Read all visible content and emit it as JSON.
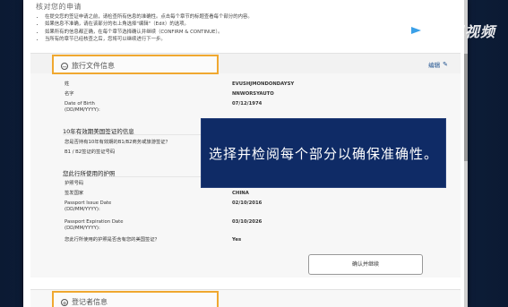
{
  "notes": {
    "heading": "核对您的申请",
    "items": [
      "在提交您的签证申请之前，请检查所有信息的准确性。点击每个章节的标题查看每个部分的内容。",
      "如果信息不准确，请在该部分的右上角选择\"编辑\"（Edit）的选项。",
      "如果所有的信息都正确，在每个章节选择确认并继续（CONFIRM & CONTINUE）。",
      "当所有的章节已经核查之后，您将可以继续进行下一步。"
    ]
  },
  "review": {
    "section_title": "旅行文件信息",
    "edit_label": "编辑",
    "fields": [
      {
        "label": "姓",
        "value": "EVUSHJMONDONDAYSY"
      },
      {
        "label": "名字",
        "value": "NNWORSYAUTO"
      },
      {
        "label": "Date of Birth (DD/MM/YYYY):",
        "value": "07/12/1974"
      }
    ],
    "visa_subtitle": "10年有效期美国签证的信息",
    "visa_fields": [
      {
        "label": "您是否持有10年有效期的B1/B2商务或旅游签证？"
      },
      {
        "label": "B1 / B2签证的签证号码"
      }
    ],
    "passport_subtitle": "您此行所使用的护照",
    "passport_fields": [
      {
        "label": "护照号码",
        "value": ""
      },
      {
        "label": "签发国家",
        "value": "CHINA"
      },
      {
        "label": "Passport Issue Date (DD/MM/YYYY):",
        "value": "02/10/2016"
      },
      {
        "label": "Passport Expiration Date (DD/MM/YYYY):",
        "value": "03/10/2026"
      },
      {
        "label": "您此行所使用的护照是否含有您的美国签证？",
        "value": "Yes"
      }
    ],
    "confirm_label": "确认并继续"
  },
  "registrant": {
    "section_title": "登记者信息"
  },
  "overlay": {
    "subtitle": "选择并检阅每个部分以确保准确性。"
  },
  "watermark": {
    "text": "腾讯视频"
  }
}
